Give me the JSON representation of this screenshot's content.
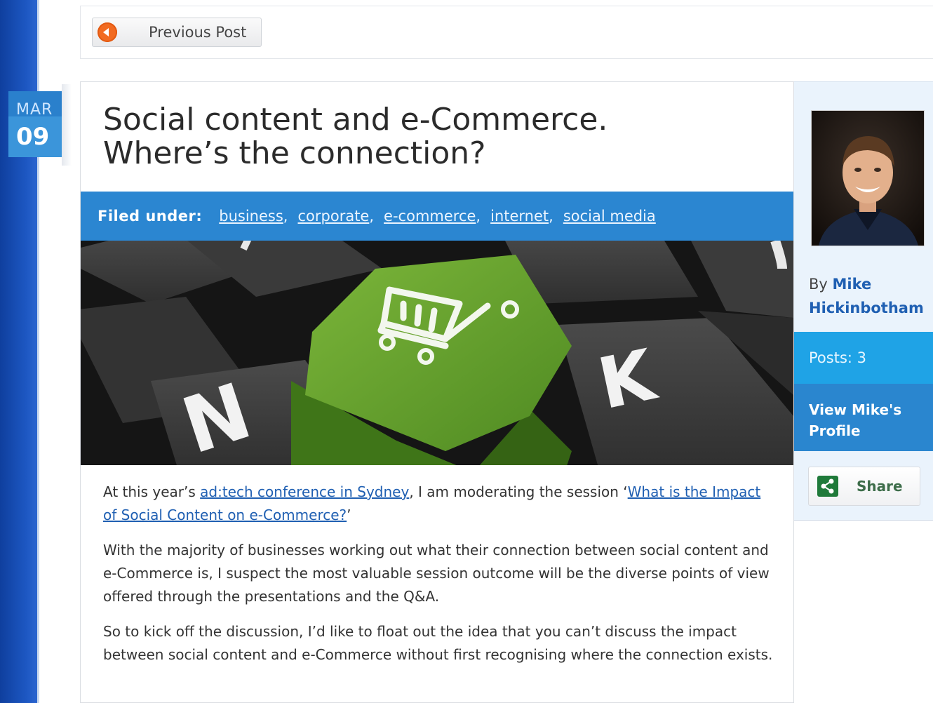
{
  "nav": {
    "previous_label": "Previous Post"
  },
  "date": {
    "month": "MAR",
    "day": "09"
  },
  "post": {
    "title_line1": "Social content and e-Commerce.",
    "title_line2": "Where’s the connection?",
    "filed_label": "Filed under:",
    "tags": [
      "business",
      "corporate",
      "e-commerce",
      "internet",
      "social media"
    ],
    "image_keys": {
      "left": "N",
      "right": "K",
      "center_icon": "shopping-cart-icon"
    },
    "p1_pre": "At this year’s ",
    "p1_link1": "ad:tech conference in Sydney",
    "p1_mid": ", I am moderating the session ‘",
    "p1_link2": "What is the Impact of Social Content on e-Commerce?",
    "p1_post": "’",
    "p2": "With the majority of businesses working out what their connection between social content and e-Commerce is, I suspect the most valuable session outcome will be the diverse points of view offered through the presentations and the Q&A.",
    "p3": "So to kick off the discussion, I’d like to float out the idea that you can’t discuss the impact between social content and e-Commerce without first recognising where the connection exists."
  },
  "author": {
    "by": "By ",
    "name": "Mike Hickinbotham",
    "posts": "Posts: 3",
    "profile_label": "View Mike's Profile",
    "share_label": "Share"
  },
  "colors": {
    "left_stripe": "#1d57c2",
    "filed_bar": "#2b86d1",
    "posts_box": "#1fa3e6",
    "profile_box": "#2a86cf",
    "green_key": "#6fa52e",
    "link": "#1f5fb2"
  }
}
